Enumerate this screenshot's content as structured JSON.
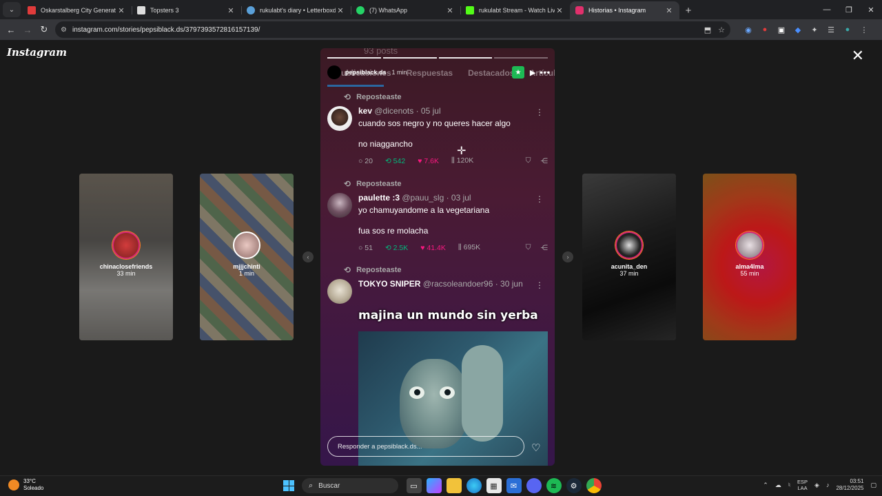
{
  "browser": {
    "tabs": [
      {
        "title": "Oskarstalberg City Generat",
        "color": "#e03b3b"
      },
      {
        "title": "Topsters 3",
        "color": "#dddddd"
      },
      {
        "title": "rukulabt's diary • Letterboxd",
        "color": "#5aa0d8"
      },
      {
        "title": "(7) WhatsApp",
        "color": "#25d366"
      },
      {
        "title": "rukulabt Stream - Watch Live o",
        "color": "#53fc18"
      },
      {
        "title": "Historias • Instagram",
        "color": "#e1306c"
      }
    ],
    "url": "instagram.com/stories/pepsiblack.ds/3797393572816157139/"
  },
  "instagram": {
    "logo": "Instagram",
    "side_stories": [
      {
        "name": "chinaclosefriends",
        "time": "33 min"
      },
      {
        "name": "mjjjchinti",
        "time": "1 min"
      },
      {
        "name": "acunita_den",
        "time": "37 min"
      },
      {
        "name": "alma4lma",
        "time": "55 min"
      }
    ],
    "story": {
      "ghost_posts": "93 posts",
      "ghost_tabs": [
        "Publicaciones",
        "Respuestas",
        "Destacados",
        "Artículos"
      ],
      "user": "pepsiblack.ds",
      "time": "1 min",
      "posts": [
        {
          "repost_label": "Reposteaste",
          "name": "kev",
          "handle": "@dicenots · 05 jul",
          "text": "cuando sos negro y no queres hacer algo",
          "text2": "no niaggancho",
          "replies": "20",
          "reposts": "542",
          "likes": "7.6K",
          "views": "120K"
        },
        {
          "repost_label": "Reposteaste",
          "name": "paulette :3",
          "handle": "@pauu_slg · 03 jul",
          "text": "yo chamuyandome a la vegetariana",
          "text2": "fua sos re molacha",
          "replies": "51",
          "reposts": "2.5K",
          "likes": "41.4K",
          "views": "695K"
        },
        {
          "repost_label": "Reposteaste",
          "name": "TOKYO SNIPER",
          "handle": "@racsoleandoer96 · 30 jun",
          "meme_caption": "majina un mundo sin yerba"
        }
      ],
      "reply_placeholder": "Responder a pepsiblack.ds..."
    }
  },
  "taskbar": {
    "temp": "33°C",
    "weather": "Soleado",
    "search": "Buscar",
    "lang1": "ESP",
    "lang2": "LAA",
    "time": "03:51",
    "date": "28/12/2025"
  }
}
